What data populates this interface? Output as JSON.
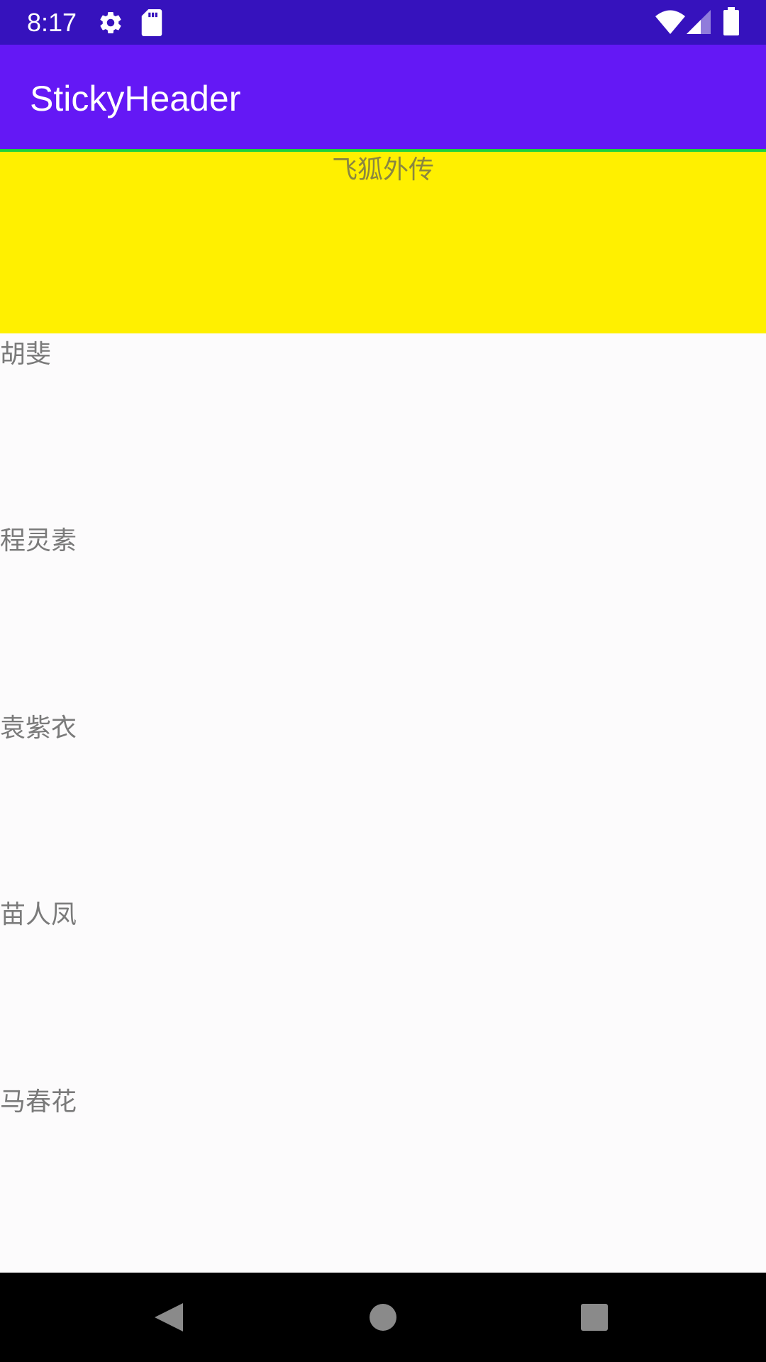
{
  "status_bar": {
    "time": "8:17",
    "icons": [
      "gear-icon",
      "sd-card-icon",
      "wifi-icon",
      "signal-icon",
      "battery-icon"
    ]
  },
  "app_bar": {
    "title": "StickyHeader"
  },
  "sticky_header": {
    "title": "飞狐外传"
  },
  "list": {
    "items": [
      {
        "label": "胡斐"
      },
      {
        "label": "程灵素"
      },
      {
        "label": "袁紫衣"
      },
      {
        "label": "苗人凤"
      },
      {
        "label": "马春花"
      }
    ]
  },
  "nav_bar": {
    "icons": [
      "back-icon",
      "home-icon",
      "recents-icon"
    ]
  },
  "colors": {
    "status_bar": "#3612bd",
    "app_bar": "#6418f5",
    "accent_line": "#1fd13a",
    "sticky_header": "#fff000",
    "background": "#fcfbfc",
    "nav_bar": "#000000"
  }
}
